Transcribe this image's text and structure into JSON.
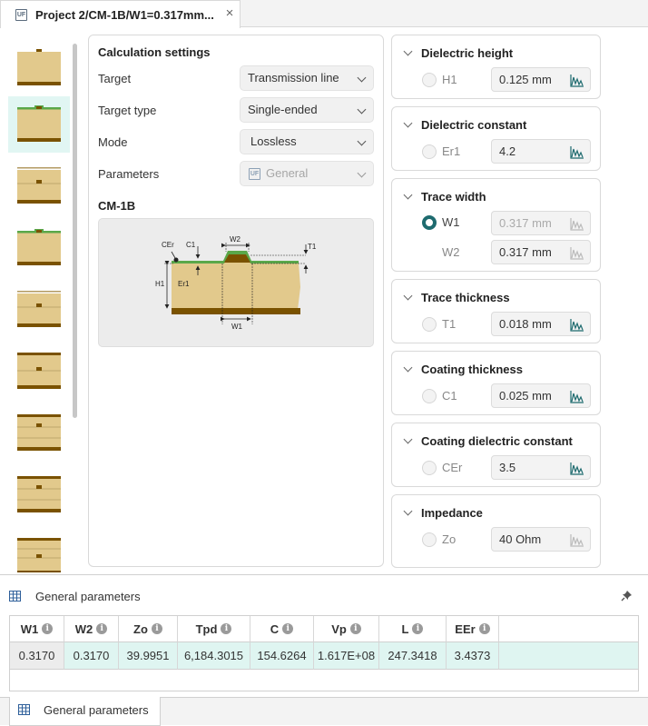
{
  "tab": {
    "title": "Project 2/CM-1B/W1=0.317mm...",
    "icon_text": "UF"
  },
  "thumbnails": [
    {
      "name": "stripline-thumb-1",
      "selected": false
    },
    {
      "name": "coated-microstrip-thumb",
      "selected": true
    },
    {
      "name": "embedded-thumb-1",
      "selected": false
    },
    {
      "name": "coated-thumb-2",
      "selected": false
    },
    {
      "name": "embedded-thumb-2",
      "selected": false
    },
    {
      "name": "stripline-thumb-2",
      "selected": false
    },
    {
      "name": "stripline-thumb-3",
      "selected": false
    },
    {
      "name": "stripline-thumb-4",
      "selected": false
    },
    {
      "name": "stripline-thumb-5",
      "selected": false
    }
  ],
  "calc": {
    "title": "Calculation settings",
    "target_label": "Target",
    "target_value": "Transmission line",
    "type_label": "Target type",
    "type_value": "Single-ended",
    "mode_label": "Mode",
    "mode_value": "Lossless",
    "params_label": "Parameters",
    "params_value": "General",
    "params_icon": "UF",
    "subtitle": "CM-1B"
  },
  "diagram": {
    "cer": "CEr",
    "c1": "C1",
    "w2": "W2",
    "t1": "T1",
    "h1": "H1",
    "er1": "Er1",
    "w1": "W1"
  },
  "groups": {
    "dh": {
      "title": "Dielectric height",
      "p1": "H1",
      "v1": "0.125 mm"
    },
    "dc": {
      "title": "Dielectric constant",
      "p1": "Er1",
      "v1": "4.2"
    },
    "tw": {
      "title": "Trace width",
      "p1": "W1",
      "v1": "0.317 mm",
      "p2": "W2",
      "v2": "0.317 mm"
    },
    "tt": {
      "title": "Trace thickness",
      "p1": "T1",
      "v1": "0.018 mm"
    },
    "ct": {
      "title": "Coating thickness",
      "p1": "C1",
      "v1": "0.025 mm"
    },
    "cdc": {
      "title": "Coating dielectric constant",
      "p1": "CEr",
      "v1": "3.5"
    },
    "imp": {
      "title": "Impedance",
      "p1": "Zo",
      "v1": "40 Ohm"
    }
  },
  "bottom": {
    "title": "General parameters",
    "columns": [
      "W1",
      "W2",
      "Zo",
      "Tpd",
      "C",
      "Vp",
      "L",
      "EEr"
    ],
    "row": [
      "0.3170",
      "0.3170",
      "39.9951",
      "6,184.3015",
      "154.6264",
      "1.617E+08",
      "247.3418",
      "3.4373"
    ]
  },
  "bottom_tab": {
    "label": "General parameters"
  },
  "colors": {
    "accent": "#1e6b6f",
    "copper": "#7a5200",
    "dielectric": "#e2c98c",
    "coating": "#5aa84a",
    "highlight": "#dff5f1"
  }
}
